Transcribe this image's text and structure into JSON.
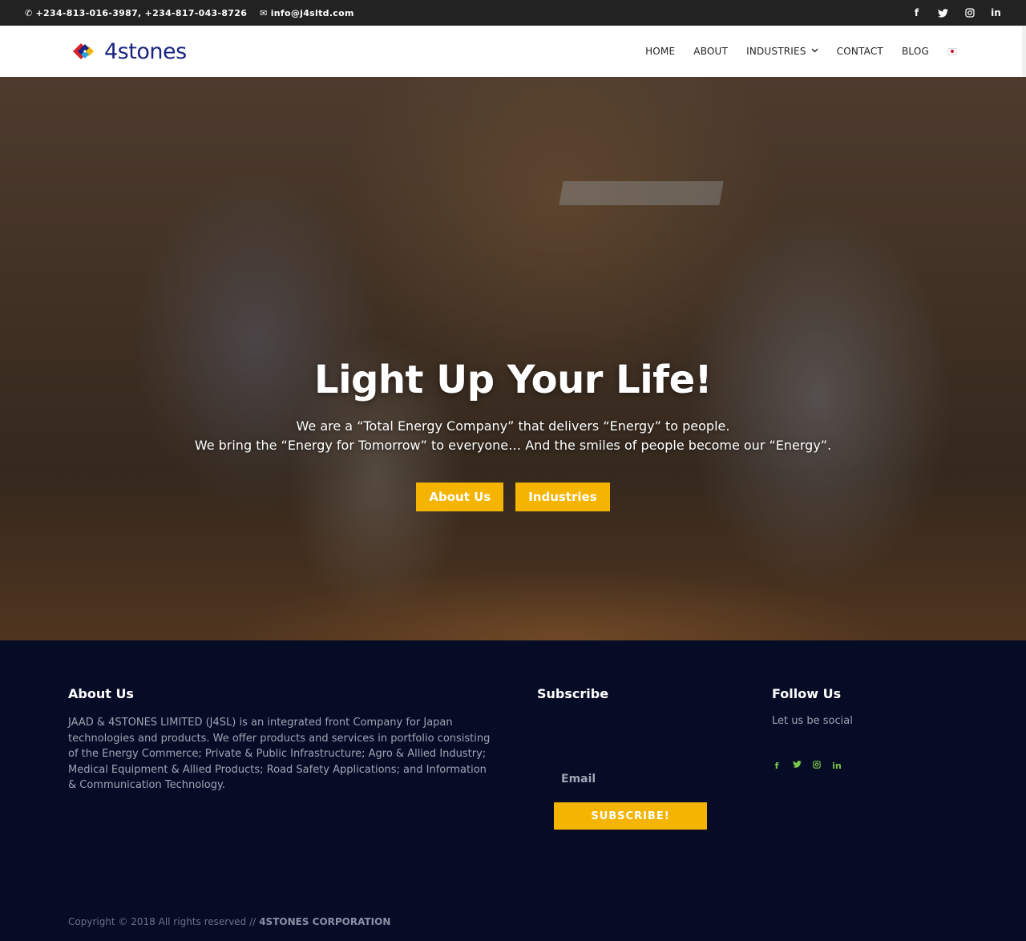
{
  "topbar": {
    "phone_icon": "phone-icon",
    "phones": "+234-813-016-3987, +234-817-043-8726",
    "email_icon": "envelope-icon",
    "email": "info@j4sltd.com",
    "social": [
      "f",
      "t",
      "ig",
      "in"
    ]
  },
  "header": {
    "logo_text": "4stones",
    "nav": {
      "home": "HOME",
      "about": "ABOUT",
      "industries": "INDUSTRIES",
      "contact": "CONTACT",
      "blog": "BLOG"
    },
    "language_flag": "japan-flag"
  },
  "hero": {
    "title": "Light Up Your Life!",
    "line1": "We are a “Total Energy Company” that delivers “Energy” to people.",
    "line2": "We bring the “Energy for Tomorrow” to everyone… And the smiles of people become our “Energy”.",
    "btn_about": "About Us",
    "btn_industries": "Industries"
  },
  "footer": {
    "about_title": "About Us",
    "about_text": "JAAD & 4STONES LIMITED (J4SL) is an integrated front Company for Japan technologies and products. We offer products and services in portfolio consisting of the Energy Commerce; Private & Public Infrastructure; Agro & Allied Industry; Medical Equipment & Allied Products; Road Safety Applications; and Information & Communication Technology.",
    "subscribe_title": "Subscribe",
    "email_placeholder": "Email",
    "subscribe_button": "SUBSCRIBE!",
    "follow_title": "Follow Us",
    "follow_text": "Let us be social",
    "copyright": "Copyright © 2018 All rights reserved //",
    "company": "4STONES CORPORATION"
  },
  "colors": {
    "accent": "#f5b400",
    "footer_bg": "#060c26",
    "social_green": "#7cc84a",
    "logo_blue": "#1b2480"
  }
}
